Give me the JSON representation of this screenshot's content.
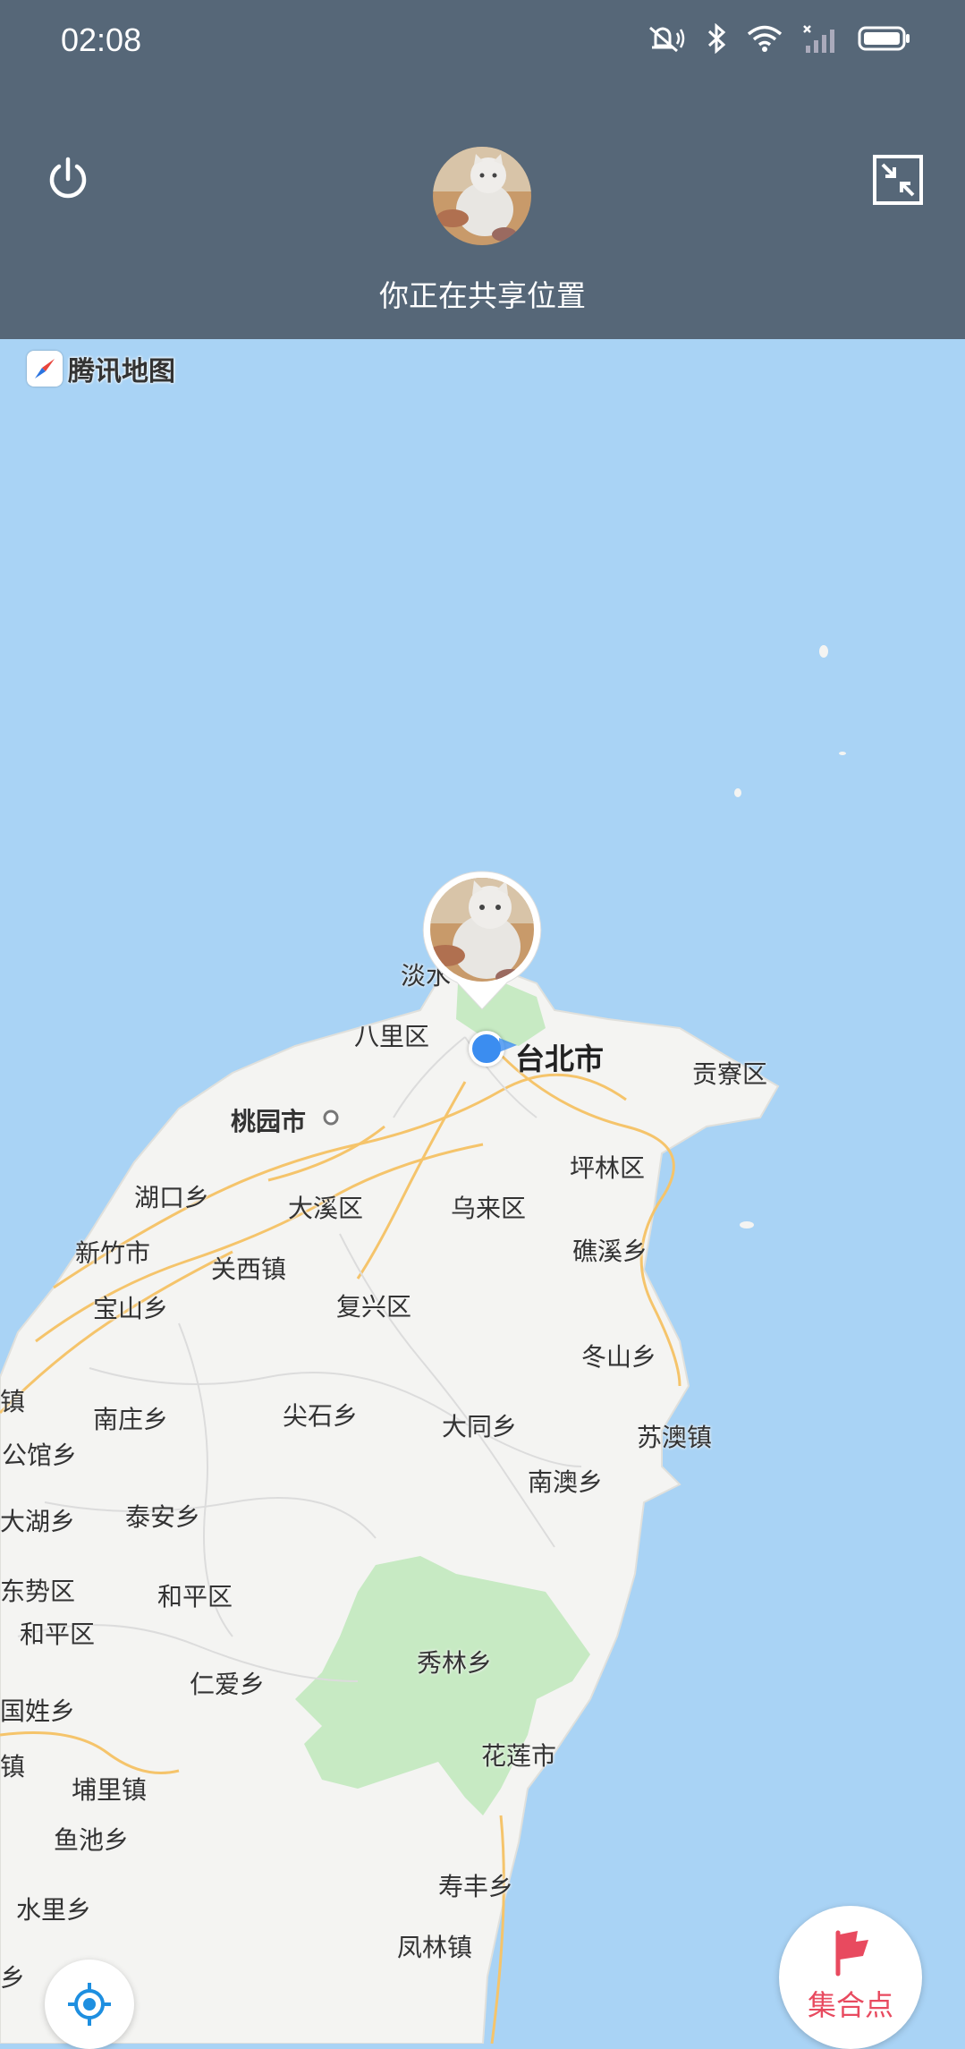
{
  "status_bar": {
    "time": "02:08",
    "icons": [
      "mute-icon",
      "bluetooth-icon",
      "wifi-icon",
      "signal-icon",
      "battery-icon"
    ]
  },
  "header": {
    "power_icon": "power-icon",
    "exit_fullscreen_icon": "exit-fullscreen-icon",
    "share_text": "你正在共享位置",
    "bg_color": "#566778"
  },
  "map": {
    "logo_text": "腾讯地图",
    "labels": [
      {
        "id": "danshui",
        "text": "淡水"
      },
      {
        "id": "bali",
        "text": "八里区"
      },
      {
        "id": "taipei",
        "text": "台北市"
      },
      {
        "id": "gongliao",
        "text": "贡寮区"
      },
      {
        "id": "taoyuan",
        "text": "桃园市"
      },
      {
        "id": "pinglin",
        "text": "坪林区"
      },
      {
        "id": "hukou",
        "text": "湖口乡"
      },
      {
        "id": "daxi",
        "text": "大溪区"
      },
      {
        "id": "wulai",
        "text": "乌来区"
      },
      {
        "id": "hsinchu",
        "text": "新竹市"
      },
      {
        "id": "guanxi",
        "text": "关西镇"
      },
      {
        "id": "jiaoxi",
        "text": "礁溪乡"
      },
      {
        "id": "baoshan",
        "text": "宝山乡"
      },
      {
        "id": "fuxing",
        "text": "复兴区"
      },
      {
        "id": "dongshan",
        "text": "冬山乡"
      },
      {
        "id": "zhen1",
        "text": "镇"
      },
      {
        "id": "nanzhuang",
        "text": "南庄乡"
      },
      {
        "id": "jianshi",
        "text": "尖石乡"
      },
      {
        "id": "datong",
        "text": "大同乡"
      },
      {
        "id": "suao",
        "text": "苏澳镇"
      },
      {
        "id": "gongguan",
        "text": "公馆乡"
      },
      {
        "id": "nanao",
        "text": "南澳乡"
      },
      {
        "id": "dahu",
        "text": "大湖乡"
      },
      {
        "id": "taian",
        "text": "泰安乡"
      },
      {
        "id": "dongshi",
        "text": "东势区"
      },
      {
        "id": "heping1",
        "text": "和平区"
      },
      {
        "id": "heping2",
        "text": "和平区"
      },
      {
        "id": "xiulin",
        "text": "秀林乡"
      },
      {
        "id": "renai",
        "text": "仁爱乡"
      },
      {
        "id": "guoxing",
        "text": "国姓乡"
      },
      {
        "id": "hualien",
        "text": "花莲市"
      },
      {
        "id": "zhen2",
        "text": "镇"
      },
      {
        "id": "puli",
        "text": "埔里镇"
      },
      {
        "id": "yuchi",
        "text": "鱼池乡"
      },
      {
        "id": "shoufeng",
        "text": "寿丰乡"
      },
      {
        "id": "shuili",
        "text": "水里乡"
      },
      {
        "id": "fenglin",
        "text": "凤林镇"
      },
      {
        "id": "xiang",
        "text": "乡"
      }
    ]
  },
  "controls": {
    "locate_icon": "locate-icon",
    "gather_icon": "flag-icon",
    "gather_label": "集合点",
    "accent_color": "#e84a5f"
  }
}
